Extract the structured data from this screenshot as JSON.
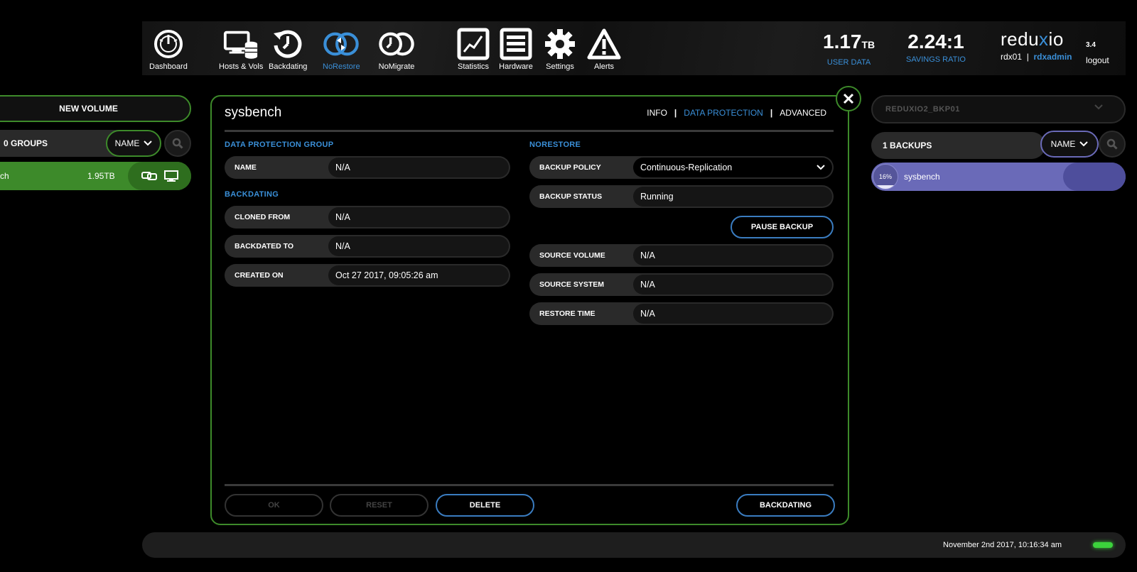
{
  "nav": {
    "items": [
      {
        "label": "Dashboard",
        "icon": "dashboard-gauge-icon"
      },
      {
        "label": "Hosts & Vols",
        "icon": "hosts-vols-icon"
      },
      {
        "label": "Backdating",
        "icon": "backdating-clock-icon"
      },
      {
        "label": "NoRestore",
        "icon": "norestore-icon",
        "active": true
      },
      {
        "label": "NoMigrate",
        "icon": "nomigrate-icon"
      },
      {
        "label": "Statistics",
        "icon": "statistics-chart-icon"
      },
      {
        "label": "Hardware",
        "icon": "hardware-icon"
      },
      {
        "label": "Settings",
        "icon": "settings-gear-icon"
      },
      {
        "label": "Alerts",
        "icon": "alerts-warning-icon"
      }
    ],
    "user_data": {
      "value": "1.17",
      "unit": "TB",
      "caption": "USER DATA"
    },
    "savings": {
      "value": "2.24:1",
      "caption": "SAVINGS RATIO"
    },
    "brand": {
      "logo_a": "redu",
      "logo_x": "x",
      "logo_b": "io",
      "version": "3.4",
      "system": "rdx01",
      "separator": "|",
      "user": "rdxadmin",
      "logout": "logout"
    }
  },
  "left": {
    "new_volume": "NEW VOLUME",
    "groups": "0 GROUPS",
    "sort": "NAME",
    "volume": {
      "name": "ch",
      "size": "1.95TB"
    }
  },
  "modal": {
    "title": "sysbench",
    "tabs": {
      "info": "INFO",
      "data_protection": "DATA PROTECTION",
      "advanced": "ADVANCED",
      "sep": "|"
    },
    "dpg": {
      "heading": "DATA PROTECTION GROUP",
      "name_label": "NAME",
      "name_value": "N/A"
    },
    "backdating": {
      "heading": "BACKDATING",
      "cloned_from_label": "CLONED FROM",
      "cloned_from_value": "N/A",
      "backdated_to_label": "BACKDATED TO",
      "backdated_to_value": "N/A",
      "created_on_label": "CREATED ON",
      "created_on_value": "Oct 27 2017, 09:05:26 am"
    },
    "norestore": {
      "heading": "NORESTORE",
      "policy_label": "BACKUP POLICY",
      "policy_value": "Continuous-Replication",
      "status_label": "BACKUP STATUS",
      "status_value": "Running",
      "pause": "PAUSE BACKUP",
      "source_volume_label": "SOURCE VOLUME",
      "source_volume_value": "N/A",
      "source_system_label": "SOURCE SYSTEM",
      "source_system_value": "N/A",
      "restore_time_label": "RESTORE TIME",
      "restore_time_value": "N/A"
    },
    "buttons": {
      "ok": "OK",
      "reset": "RESET",
      "delete": "DELETE",
      "backdating": "BACKDATING"
    }
  },
  "right": {
    "system_select": "REDUXIO2_BKP01",
    "backups": "1 BACKUPS",
    "sort": "NAME",
    "backup": {
      "progress_label": "16%",
      "progress": 0.16,
      "name": "sysbench"
    }
  },
  "status": {
    "timestamp": "November 2nd 2017, 10:16:34 am",
    "led_color": "#3cd23c"
  }
}
